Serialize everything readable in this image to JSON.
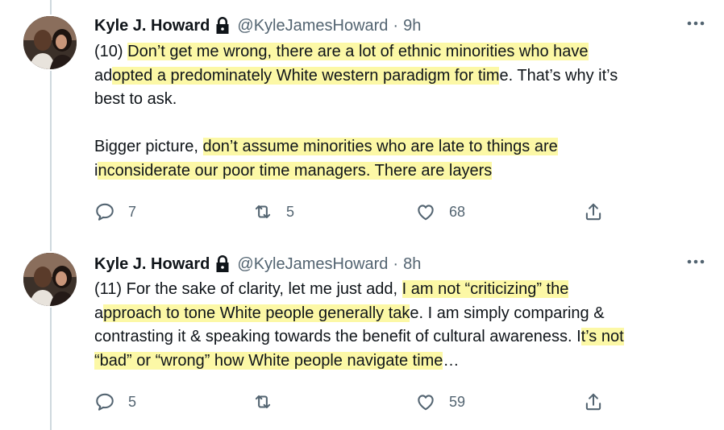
{
  "tweets": [
    {
      "author": {
        "name": "Kyle J. Howard",
        "handle": "@KyleJamesHoward",
        "time": "9h",
        "protected_icon": "lock-icon"
      },
      "text": {
        "line1_a": "(10) ",
        "line1_b": "Don’t get me wrong, there are a lot of ethnic minorities who have",
        "line2_a": "ad",
        "line2_b": "opted a predominately White western paradigm for tim",
        "line2_c": "e. That’s why it’s",
        "line3": "best to ask.",
        "line4_a": "Bigger picture, ",
        "line4_b": "don’t assume minorities who are late to things are",
        "line5_a": "i",
        "line5_b": "nconsiderate our poor time managers. There are layers"
      },
      "actions": {
        "replies": "7",
        "retweets": "5",
        "likes": "68"
      }
    },
    {
      "author": {
        "name": "Kyle J. Howard",
        "handle": "@KyleJamesHoward",
        "time": "8h",
        "protected_icon": "lock-icon"
      },
      "text": {
        "line1_a": "(11) For the sake of clarity, let me just add, ",
        "line1_b": "I am not “criticizing” the",
        "line2_a": "a",
        "line2_b": "pproach to tone White people generally tak",
        "line2_c": "e. I am simply comparing &",
        "line3_a": "contrasting it & speaking towards the benefit of cultural awareness. I",
        "line3_b": "t’s not",
        "line4_a": "“bad” or “wrong” how White people navigate time",
        "line4_b": "…"
      },
      "actions": {
        "replies": "5",
        "retweets": "",
        "likes": "59"
      }
    }
  ],
  "colors": {
    "highlight": "#fcf8a6",
    "secondary_text": "#536471",
    "thread_line": "#cfd9de"
  }
}
